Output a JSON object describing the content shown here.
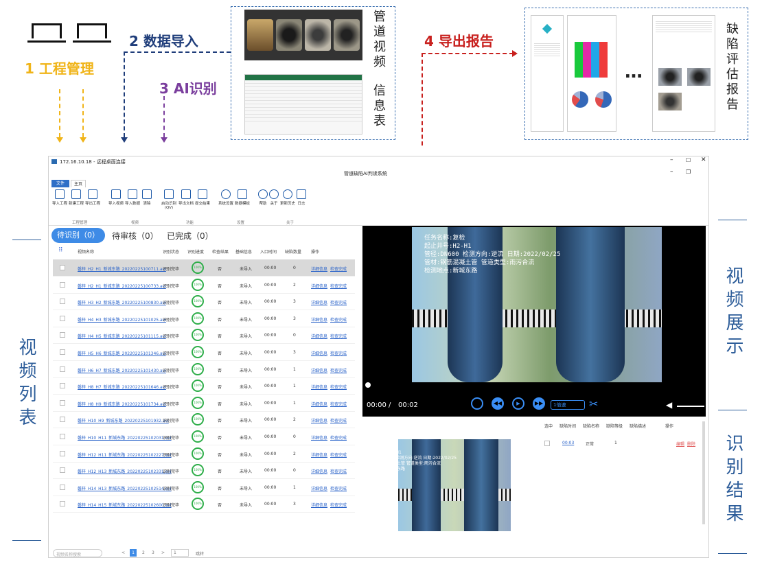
{
  "steps": {
    "step1": "1 工程管理",
    "step2": "2 数据导入",
    "step3": "3 AI识别",
    "step4": "4 导出报告"
  },
  "inputs": {
    "video_label": "管道视频",
    "info_label": "信息表"
  },
  "report": {
    "label": "缺陷评估报告",
    "ellipsis": "…"
  },
  "side_labels": {
    "video_list": "视频列表",
    "video_display": "视频展示",
    "recognition_result": "识别结果"
  },
  "app": {
    "window_title": "172.16.10.18 - 远程桌面连接",
    "system_title": "管道缺陷AI判读系统",
    "menu_tabs": [
      "文件",
      "主页"
    ],
    "toolbar": [
      {
        "label": "导入工程",
        "icon": "folder-icon"
      },
      {
        "label": "新建工程",
        "icon": "new-project-icon"
      },
      {
        "label": "导出工程",
        "icon": "export-icon"
      },
      {
        "label": "导入视频",
        "icon": "video-import-icon"
      },
      {
        "label": "导入数据",
        "icon": "data-import-icon"
      },
      {
        "label": "清除",
        "icon": "trash-icon"
      },
      {
        "label": "启动识别(QV)",
        "icon": "scan-icon"
      },
      {
        "label": "导出文档",
        "icon": "word-icon"
      },
      {
        "label": "提交结果",
        "icon": "chart-icon"
      },
      {
        "label": "系统设置",
        "icon": "gear-icon"
      },
      {
        "label": "数据模板",
        "icon": "template-icon"
      },
      {
        "label": "帮助",
        "icon": "help-icon"
      },
      {
        "label": "关于",
        "icon": "info-icon"
      },
      {
        "label": "更新历史",
        "icon": "history-icon"
      },
      {
        "label": "日志",
        "icon": "log-icon"
      }
    ],
    "groups": [
      "工程管理",
      "视频",
      "功能",
      "设置",
      "关于"
    ],
    "tabs": {
      "pending": "待识别（0）",
      "review": "待审核（0）",
      "done": "已完成（0）"
    },
    "columns": [
      "视频名称",
      "识别状态",
      "识别进度",
      "检查结果",
      "基础信息",
      "入口时间",
      "缺陷数量",
      "操作"
    ],
    "rows": [
      {
        "name": "磐梓_H2_H1_新城东路_20220225100711.avi",
        "status": "识别完毕",
        "progress": "100%",
        "check": "否",
        "base": "未导入",
        "time": "00:00",
        "count": "0"
      },
      {
        "name": "磐梓_H2_H1_新城东路_20220225100733.avi",
        "status": "识别完毕",
        "progress": "100%",
        "check": "否",
        "base": "未导入",
        "time": "00:00",
        "count": "2"
      },
      {
        "name": "磐梓_H3_H2_新城东路_20220225100830.avi",
        "status": "识别完毕",
        "progress": "100%",
        "check": "否",
        "base": "未导入",
        "time": "00:00",
        "count": "3"
      },
      {
        "name": "磐梓_H4_H3_新城东路_20220225101025.avi",
        "status": "识别完毕",
        "progress": "100%",
        "check": "否",
        "base": "未导入",
        "time": "00:00",
        "count": "3"
      },
      {
        "name": "磐梓_H4_H5_新城东路_20220225101115.avi",
        "status": "识别完毕",
        "progress": "100%",
        "check": "否",
        "base": "未导入",
        "time": "00:00",
        "count": "0"
      },
      {
        "name": "磐梓_H5_H6_新城东路_20220225101346.avi",
        "status": "识别完毕",
        "progress": "100%",
        "check": "否",
        "base": "未导入",
        "time": "00:00",
        "count": "3"
      },
      {
        "name": "磐梓_H6_H7_新城东路_20220225101430.avi",
        "status": "识别完毕",
        "progress": "100%",
        "check": "否",
        "base": "未导入",
        "time": "00:00",
        "count": "1"
      },
      {
        "name": "磐梓_H8_H7_新城东路_20220225101646.avi",
        "status": "识别完毕",
        "progress": "100%",
        "check": "否",
        "base": "未导入",
        "time": "00:00",
        "count": "1"
      },
      {
        "name": "磐梓_H8_H9_新城东路_20220225101734.avi",
        "status": "识别完毕",
        "progress": "100%",
        "check": "否",
        "base": "未导入",
        "time": "00:00",
        "count": "1"
      },
      {
        "name": "磐梓_H10_H9_新城东路_20220225101932.avi",
        "status": "识别完毕",
        "progress": "100%",
        "check": "否",
        "base": "未导入",
        "time": "00:00",
        "count": "2"
      },
      {
        "name": "磐梓_H10_H11_新城东路_20220225102031.avi",
        "status": "识别完毕",
        "progress": "100%",
        "check": "否",
        "base": "未导入",
        "time": "00:00",
        "count": "0"
      },
      {
        "name": "磐梓_H12_H11_新城东路_20220225102227.avi",
        "status": "识别完毕",
        "progress": "100%",
        "check": "否",
        "base": "未导入",
        "time": "00:00",
        "count": "2"
      },
      {
        "name": "磐梓_H12_H13_新城东路_20220225102331.avi",
        "status": "识别完毕",
        "progress": "100%",
        "check": "否",
        "base": "未导入",
        "time": "00:00",
        "count": "0"
      },
      {
        "name": "磐梓_H14_H13_新城东路_20220225102514.avi",
        "status": "识别完毕",
        "progress": "100%",
        "check": "否",
        "base": "未导入",
        "time": "00:00",
        "count": "1"
      },
      {
        "name": "磐梓_H14_H15_新城东路_20220225102600.avi",
        "status": "识别完毕",
        "progress": "100%",
        "check": "否",
        "base": "未导入",
        "time": "00:00",
        "count": "3"
      }
    ],
    "row_actions": {
      "detail": "详细信息",
      "check": "检查完成"
    },
    "pager": {
      "search_placeholder": "视频名称搜索",
      "pages": [
        "<",
        "1",
        "2",
        "3",
        ">",
        "1"
      ],
      "goto": "跳转"
    },
    "video": {
      "overlay_lines": [
        "任务名称:复检",
        "起止井号:H2-H1",
        "管径:DN600 检测方向:逆流 日期:2022/02/25",
        "管材:钢筋混凝土管 管道类型:雨污合流",
        "检测地点:新城东路"
      ],
      "time_current": "00:00",
      "time_sep": "/",
      "time_total": "00:02",
      "speed": "1倍速"
    },
    "result": {
      "columns": [
        "选中",
        "缺陷时间",
        "缺陷名称",
        "缺陷等级",
        "缺陷描述",
        "操作"
      ],
      "row": {
        "time": "00:03",
        "name": "正常",
        "level": "1",
        "edit": "编辑",
        "delete": "删除"
      },
      "overlay_lines": [
        "任务名称:复检",
        "起止井号:H2-H1",
        "管径:DN600 检测方向:逆流 日期:2022/02/25",
        "管材:钢筋混凝土管 管道类型:雨污合流",
        "检测地点:新城东路"
      ]
    }
  }
}
